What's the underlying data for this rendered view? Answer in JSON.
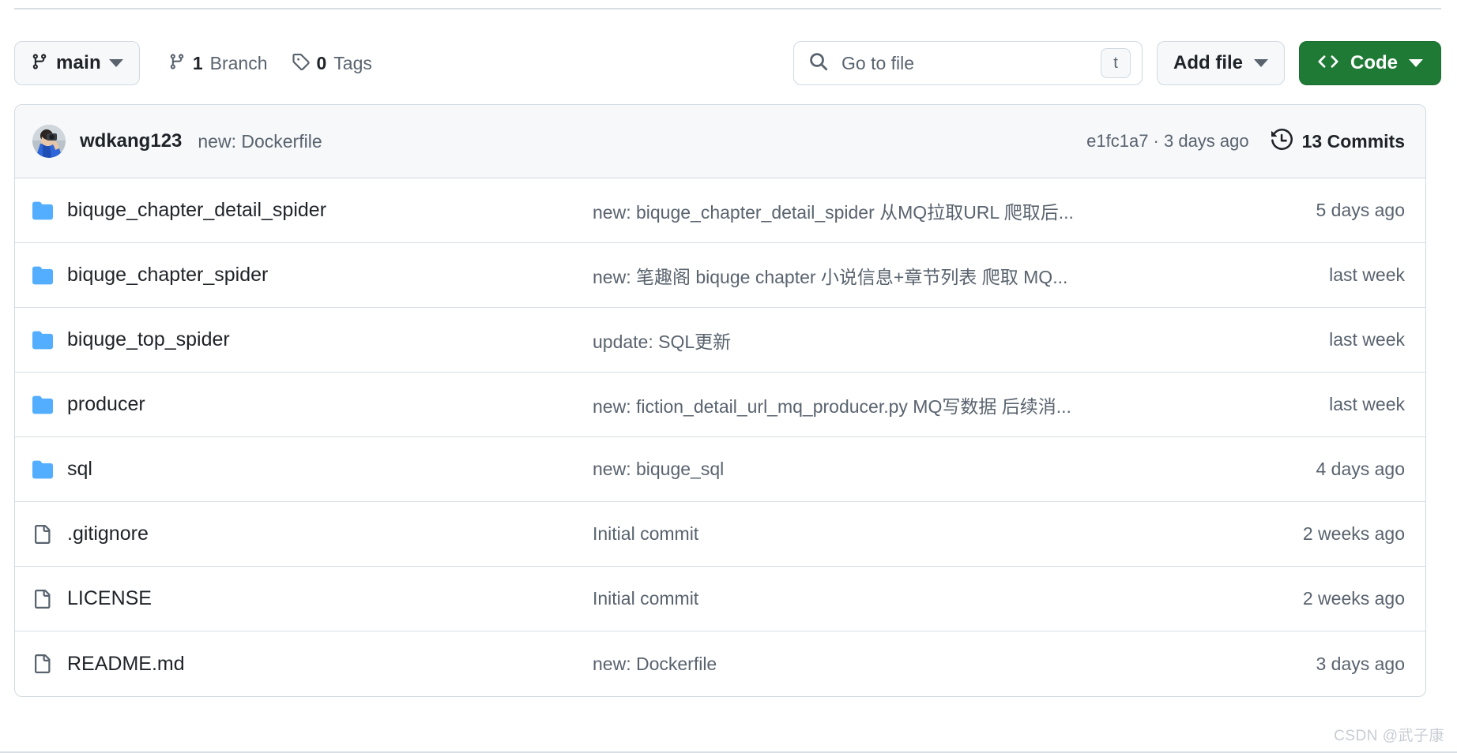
{
  "toolbar": {
    "branch": {
      "icon": "git-branch-icon",
      "label": "main",
      "caret": "chevron-down-icon"
    },
    "branch_count": {
      "icon": "git-branch-icon",
      "number": "1",
      "word": "Branch"
    },
    "tag_count": {
      "icon": "tag-icon",
      "number": "0",
      "word": "Tags"
    },
    "search": {
      "icon": "search-icon",
      "placeholder": "Go to file",
      "value": "",
      "shortcut": "t"
    },
    "add_file": {
      "label": "Add file",
      "caret": "chevron-down-icon"
    },
    "code": {
      "icon": "code-brackets-icon",
      "label": "Code",
      "caret": "chevron-down-icon",
      "color": "#1f7a36"
    }
  },
  "commit_header": {
    "avatar_alt": "wdkang123",
    "author": "wdkang123",
    "message": "new: Dockerfile",
    "sha_time": "e1fc1a7 · 3 days ago",
    "commits_icon": "history-clock-icon",
    "commits_label": "13 Commits"
  },
  "files": [
    {
      "type": "folder",
      "icon": "folder-icon",
      "name": "biquge_chapter_detail_spider",
      "message": "new: biquge_chapter_detail_spider 从MQ拉取URL 爬取后...",
      "time": "5 days ago"
    },
    {
      "type": "folder",
      "icon": "folder-icon",
      "name": "biquge_chapter_spider",
      "message": "new: 笔趣阁 biquge chapter 小说信息+章节列表 爬取 MQ...",
      "time": "last week"
    },
    {
      "type": "folder",
      "icon": "folder-icon",
      "name": "biquge_top_spider",
      "message": "update: SQL更新",
      "time": "last week"
    },
    {
      "type": "folder",
      "icon": "folder-icon",
      "name": "producer",
      "message": "new: fiction_detail_url_mq_producer.py MQ写数据 后续消...",
      "time": "last week"
    },
    {
      "type": "folder",
      "icon": "folder-icon",
      "name": "sql",
      "message": "new: biquge_sql",
      "time": "4 days ago"
    },
    {
      "type": "file",
      "icon": "file-icon",
      "name": ".gitignore",
      "message": "Initial commit",
      "time": "2 weeks ago"
    },
    {
      "type": "file",
      "icon": "file-icon",
      "name": "LICENSE",
      "message": "Initial commit",
      "time": "2 weeks ago"
    },
    {
      "type": "file",
      "icon": "file-icon",
      "name": "README.md",
      "message": "new: Dockerfile",
      "time": "3 days ago"
    }
  ],
  "watermark": "CSDN @武子康",
  "colors": {
    "folder_blue": "#54aeff",
    "code_green": "#1f7a36",
    "muted_text": "#59636e",
    "border": "#d1d9e0",
    "header_bg": "#f6f8fa"
  }
}
